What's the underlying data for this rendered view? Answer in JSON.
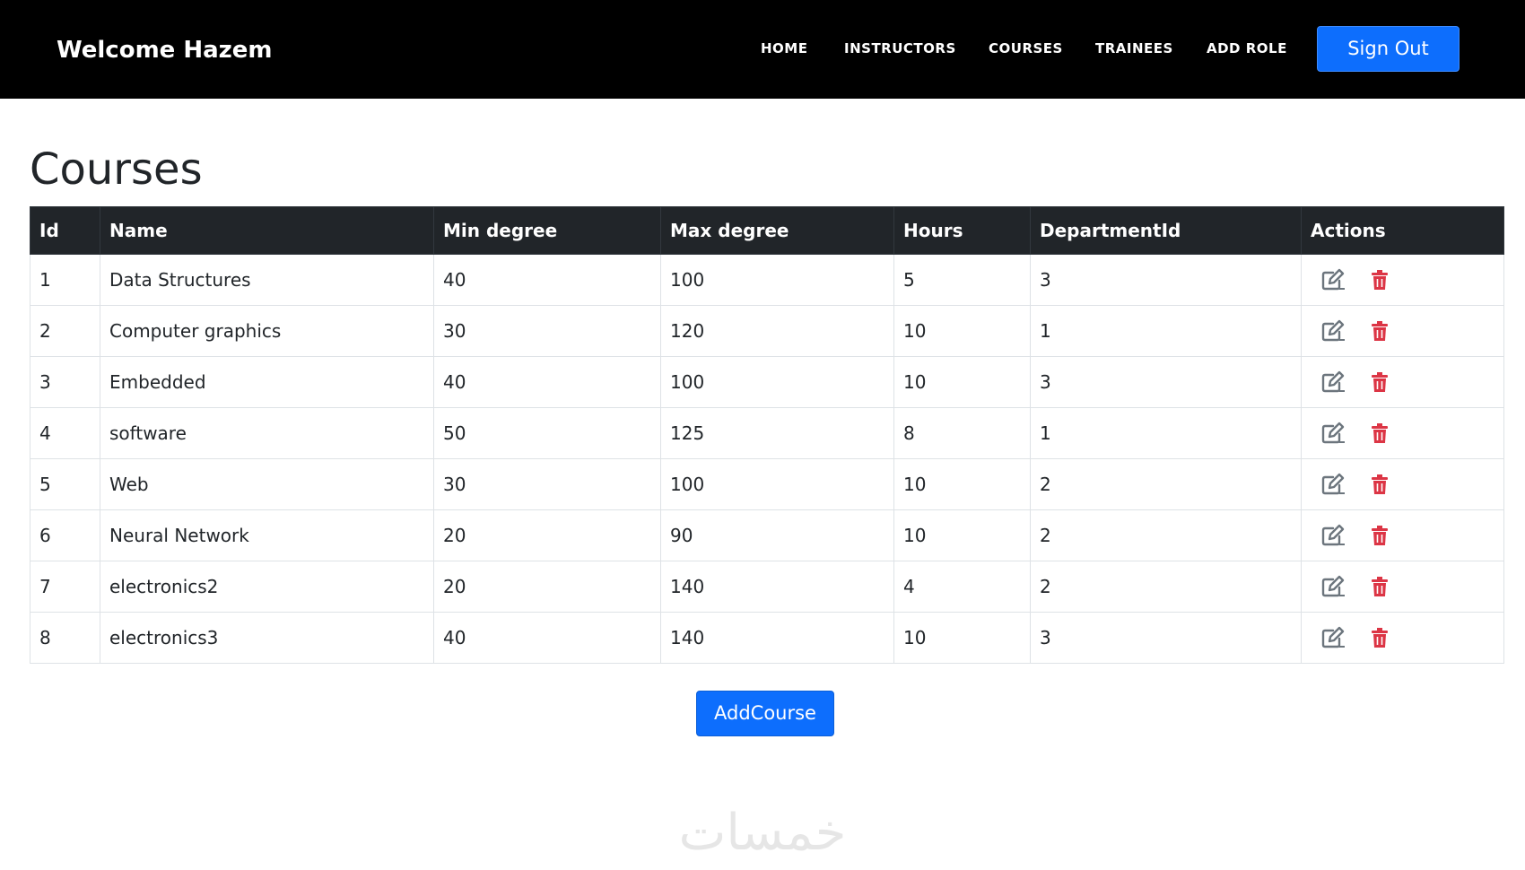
{
  "navbar": {
    "brand": "Welcome Hazem",
    "links": [
      "HOME",
      "INSTRUCTORS",
      "COURSES",
      "TRAINEES",
      "ADD ROLE"
    ],
    "signout_label": "Sign Out"
  },
  "page": {
    "title": "Courses"
  },
  "table": {
    "headers": [
      "Id",
      "Name",
      "Min degree",
      "Max degree",
      "Hours",
      "DepartmentId",
      "Actions"
    ],
    "rows": [
      [
        "1",
        "Data Structures",
        "40",
        "100",
        "5",
        "3"
      ],
      [
        "2",
        "Computer graphics",
        "30",
        "120",
        "10",
        "1"
      ],
      [
        "3",
        "Embedded",
        "40",
        "100",
        "10",
        "3"
      ],
      [
        "4",
        "software",
        "50",
        "125",
        "8",
        "1"
      ],
      [
        "5",
        "Web",
        "30",
        "100",
        "10",
        "2"
      ],
      [
        "6",
        "Neural Network",
        "20",
        "90",
        "10",
        "2"
      ],
      [
        "7",
        "electronics2",
        "20",
        "140",
        "4",
        "2"
      ],
      [
        "8",
        "electronics3",
        "40",
        "140",
        "10",
        "3"
      ]
    ],
    "row_actions": [
      "edit-icon",
      "trash-icon"
    ]
  },
  "add_course_label": "AddCourse",
  "watermark": {
    "text": "خمسات",
    "icon": "khamsat-logo"
  },
  "colors": {
    "navbar_bg": "#000000",
    "primary": "#0d6efd",
    "table_header_bg": "#212529",
    "delete": "#dc3545",
    "edit": "#6c757d"
  }
}
